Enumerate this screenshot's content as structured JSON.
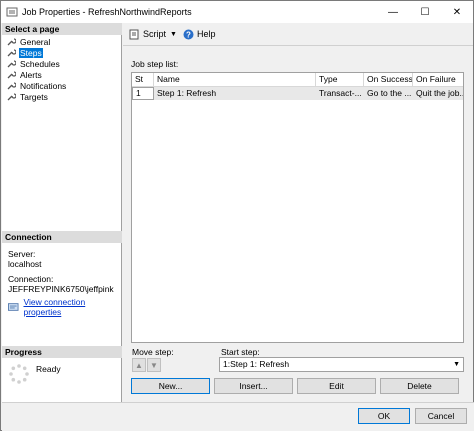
{
  "window": {
    "title": "Job Properties - RefreshNorthwindReports",
    "minimize_label": "—",
    "maximize_label": "☐",
    "close_label": "✕"
  },
  "left": {
    "select_page_header": "Select a page",
    "pages": [
      {
        "label": "General",
        "selected": false
      },
      {
        "label": "Steps",
        "selected": true
      },
      {
        "label": "Schedules",
        "selected": false
      },
      {
        "label": "Alerts",
        "selected": false
      },
      {
        "label": "Notifications",
        "selected": false
      },
      {
        "label": "Targets",
        "selected": false
      }
    ],
    "connection_header": "Connection",
    "server_label": "Server:",
    "server_value": "localhost",
    "connection_label": "Connection:",
    "connection_value": "JEFFREYPINK6750\\jeffpink",
    "view_connection_link": "View connection properties",
    "progress_header": "Progress",
    "progress_status": "Ready"
  },
  "toolbar": {
    "script_label": "Script",
    "help_label": "Help"
  },
  "steps": {
    "list_label": "Job step list:",
    "columns": [
      "St",
      "Name",
      "Type",
      "On Success",
      "On Failure"
    ],
    "rows": [
      {
        "step": "1",
        "name": "Step 1: Refresh",
        "type": "Transact-...",
        "on_success": "Go to the ...",
        "on_failure": "Quit the job..."
      }
    ],
    "move_step_label": "Move step:",
    "start_step_label": "Start step:",
    "start_step_value": "1:Step 1: Refresh",
    "buttons": {
      "new": "New...",
      "insert": "Insert...",
      "edit": "Edit",
      "delete": "Delete"
    }
  },
  "footer": {
    "ok": "OK",
    "cancel": "Cancel"
  },
  "colors": {
    "selection": "#0078d7",
    "link": "#0033cc",
    "section_header": "#dcdcdc"
  }
}
